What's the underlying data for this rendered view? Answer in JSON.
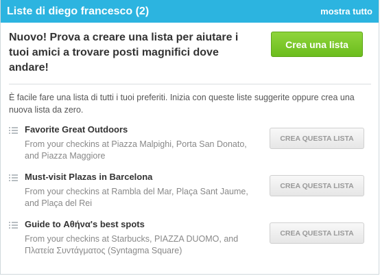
{
  "header": {
    "title": "Liste di diego francesco (2)",
    "link": "mostra tutto"
  },
  "promo": {
    "text": "Nuovo! Prova a creare una lista per aiutare i tuoi amici a trovare posti magnifici dove andare!",
    "button": "Crea una lista"
  },
  "intro": "È facile fare una lista di tutti i tuoi preferiti. Inizia con queste liste suggerite oppure crea una nuova lista da zero.",
  "lists": [
    {
      "title": "Favorite Great Outdoors",
      "desc": "From your checkins at Piazza Malpighi, Porta San Donato, and Piazza Maggiore",
      "button": "CREA QUESTA LISTA"
    },
    {
      "title": "Must-visit Plazas in Barcelona",
      "desc": "From your checkins at Rambla del Mar, Plaça Sant Jaume, and Plaça del Rei",
      "button": "CREA QUESTA LISTA"
    },
    {
      "title": "Guide to Αθήνα's best spots",
      "desc": "From your checkins at Starbucks, PIAZZA DUOMO, and Πλατεία Συντάγματος (Syntagma Square)",
      "button": "CREA QUESTA LISTA"
    }
  ],
  "colors": {
    "header": "#2cb4e0",
    "primary_button": "#7cc72b"
  }
}
